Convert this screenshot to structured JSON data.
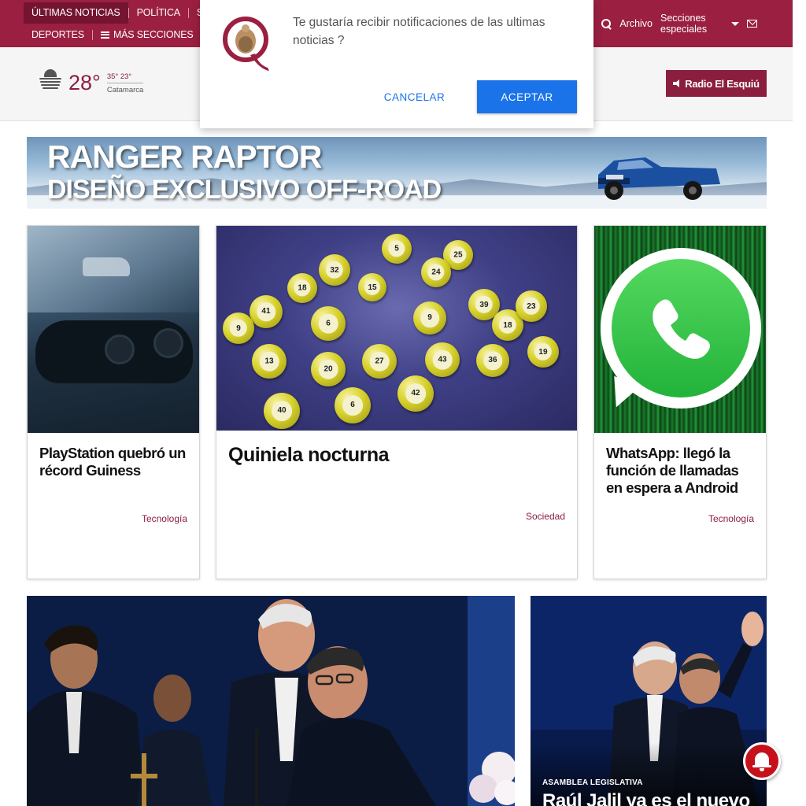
{
  "nav": {
    "row1": [
      "ÚLTIMAS NOTICIAS",
      "POLÍTICA",
      "SOCIE"
    ],
    "row2": [
      "DEPORTES",
      "MÁS SECCIONES"
    ],
    "archivo": "Archivo",
    "secciones_especiales": "Secciones especiales"
  },
  "weather": {
    "temp": "28°",
    "max": "35°",
    "min": "23°",
    "city": "Catamarca"
  },
  "radio": {
    "label": "Radio El Esquiú"
  },
  "notification": {
    "message": "Te gustaría recibir notificaciones de las ultimas noticias ?",
    "cancel": "CANCELAR",
    "accept": "ACEPTAR"
  },
  "banner": {
    "line1": "RANGER RAPTOR",
    "line2": "DISEÑO EXCLUSIVO OFF-ROAD"
  },
  "cards": [
    {
      "title": "PlayStation quebró un récord Guiness",
      "category": "Tecnología"
    },
    {
      "title": "Quiniela nocturna",
      "category": "Sociedad"
    },
    {
      "title": "WhatsApp: llegó la función de llamadas en espera a Android",
      "category": "Tecnología"
    }
  ],
  "lottery_balls": [
    "25",
    "32",
    "5",
    "15",
    "41",
    "39",
    "6",
    "9",
    "18",
    "20",
    "27",
    "43",
    "13",
    "42",
    "6",
    "40",
    "36",
    "23",
    "18",
    "24",
    "9",
    "19"
  ],
  "feature": {
    "kicker": "ASAMBLEA LEGISLATIVA",
    "headline": "Raúl Jalil ya es el nuevo"
  },
  "colors": {
    "brand": "#9a1f40",
    "accent_button": "#1a73e8",
    "bell": "#c6111b"
  }
}
